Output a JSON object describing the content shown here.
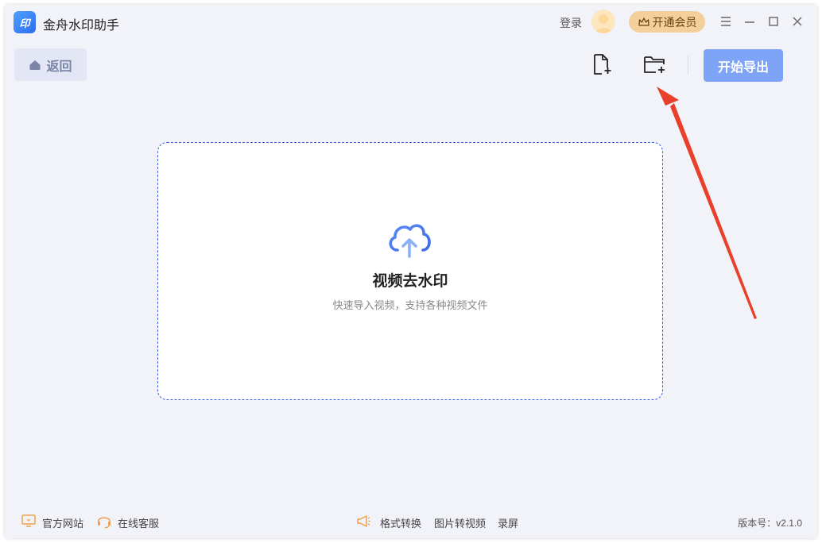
{
  "app": {
    "title": "金舟水印助手",
    "logo_text": "印"
  },
  "header": {
    "login_label": "登录",
    "vip_label": "开通会员"
  },
  "toolbar": {
    "back_label": "返回",
    "export_label": "开始导出"
  },
  "dropzone": {
    "title": "视频去水印",
    "subtitle": "快速导入视频，支持各种视频文件"
  },
  "footer": {
    "official_site": "官方网站",
    "online_service": "在线客服",
    "format_convert": "格式转换",
    "image_to_video": "图片转视频",
    "screen_record": "录屏",
    "version": "版本号：v2.1.0"
  },
  "colors": {
    "accent": "#7ea4f7",
    "dashed_border": "#3b5fe0",
    "annotation": "#e8402a",
    "vip_bg": "#f3cf9b"
  }
}
